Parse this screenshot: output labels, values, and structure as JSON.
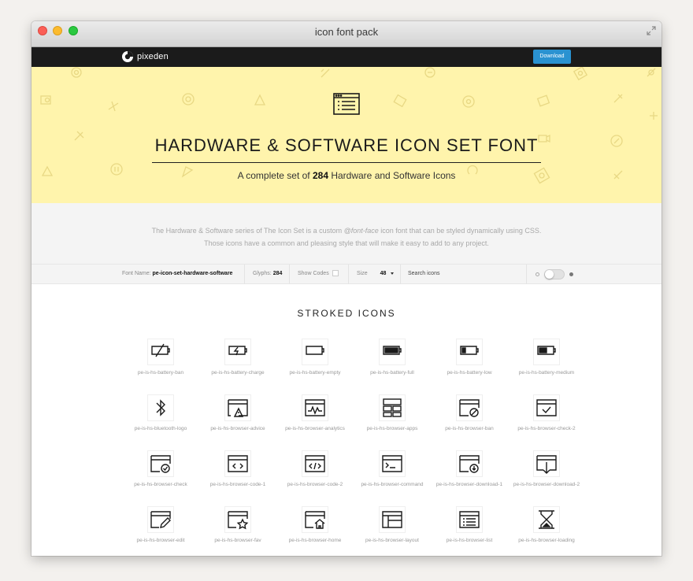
{
  "window": {
    "title": "icon font pack"
  },
  "navbar": {
    "logo_text": "pixeden",
    "download_label": "Download"
  },
  "hero": {
    "title": "HARDWARE & SOFTWARE ICON SET FONT",
    "subtitle_before": "A complete set of ",
    "subtitle_count": "284",
    "subtitle_after": " Hardware and Software Icons"
  },
  "description": {
    "line1_a": "The Hardware & Software series of The Icon Set is a custom ",
    "line1_em": "@font-face",
    "line1_b": " icon font that can be styled dynamically using CSS.",
    "line2": "Those icons have a common and pleasing style that will make it easy to add to any project."
  },
  "toolbar": {
    "font_name_label": "Font Name:",
    "font_name_value": "pe-icon-set-hardware-software",
    "glyphs_label": "Glyphs:",
    "glyphs_value": "284",
    "show_codes_label": "Show Codes",
    "size_label": "Size",
    "size_value": "48",
    "search_label": "Search icons"
  },
  "section_title": "STROKED ICONS",
  "icons": [
    {
      "label": "pe-is-hs-battery-ban",
      "icon": "battery-ban-icon"
    },
    {
      "label": "pe-is-hs-battery-charge",
      "icon": "battery-charge-icon"
    },
    {
      "label": "pe-is-hs-battery-empty",
      "icon": "battery-empty-icon"
    },
    {
      "label": "pe-is-hs-battery-full",
      "icon": "battery-full-icon"
    },
    {
      "label": "pe-is-hs-battery-low",
      "icon": "battery-low-icon"
    },
    {
      "label": "pe-is-hs-battery-medium",
      "icon": "battery-medium-icon"
    },
    {
      "label": "pe-is-hs-bluetooth-logo",
      "icon": "bluetooth-icon"
    },
    {
      "label": "pe-is-hs-browser-advice",
      "icon": "browser-advice-icon"
    },
    {
      "label": "pe-is-hs-browser-analytics",
      "icon": "browser-analytics-icon"
    },
    {
      "label": "pe-is-hs-browser-apps",
      "icon": "browser-apps-icon"
    },
    {
      "label": "pe-is-hs-browser-ban",
      "icon": "browser-ban-icon"
    },
    {
      "label": "pe-is-hs-browser-check-2",
      "icon": "browser-check-2-icon"
    },
    {
      "label": "pe-is-hs-browser-check",
      "icon": "browser-check-icon"
    },
    {
      "label": "pe-is-hs-browser-code-1",
      "icon": "browser-code-1-icon"
    },
    {
      "label": "pe-is-hs-browser-code-2",
      "icon": "browser-code-2-icon"
    },
    {
      "label": "pe-is-hs-browser-command",
      "icon": "browser-command-icon"
    },
    {
      "label": "pe-is-hs-browser-download-1",
      "icon": "browser-download-1-icon"
    },
    {
      "label": "pe-is-hs-browser-download-2",
      "icon": "browser-download-2-icon"
    },
    {
      "label": "pe-is-hs-browser-edit",
      "icon": "browser-edit-icon"
    },
    {
      "label": "pe-is-hs-browser-fav",
      "icon": "browser-fav-icon"
    },
    {
      "label": "pe-is-hs-browser-home",
      "icon": "browser-home-icon"
    },
    {
      "label": "pe-is-hs-browser-layout",
      "icon": "browser-layout-icon"
    },
    {
      "label": "pe-is-hs-browser-list",
      "icon": "browser-list-icon"
    },
    {
      "label": "pe-is-hs-browser-loading",
      "icon": "browser-loading-icon"
    }
  ],
  "colors": {
    "hero_bg": "#fff4ac",
    "navbar_bg": "#1b1b1b",
    "download_btn": "#2a92d1"
  }
}
